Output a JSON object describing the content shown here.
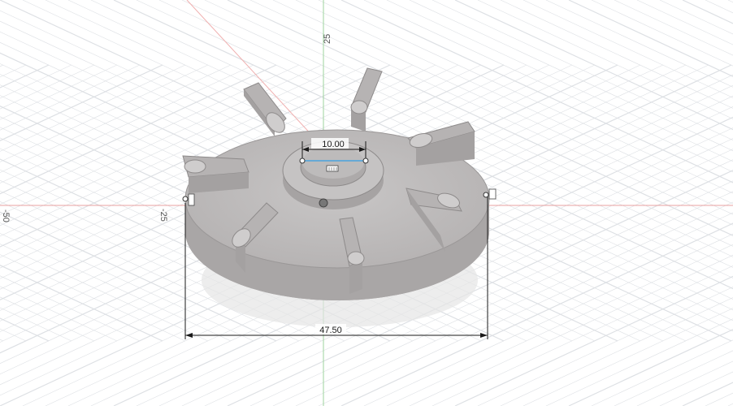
{
  "axis_labels": {
    "y_top": "25",
    "x_left": "-25",
    "x_far_left": "-50"
  },
  "dimensions": {
    "hub_diameter": "10.00",
    "outer_diameter": "47.50"
  },
  "colors": {
    "background": "#ffffff",
    "grid": "#dde0e4",
    "x_axis": "#e8a0a0",
    "y_axis": "#9ed39e",
    "dimension": "#1a1a1a",
    "part_top": "#bfbcbc",
    "part_side": "#a9a6a6",
    "highlight": "#4aa3df"
  },
  "icons": {
    "sketch_constraint": "sketch-constraint-icon",
    "origin": "origin-point-icon"
  }
}
